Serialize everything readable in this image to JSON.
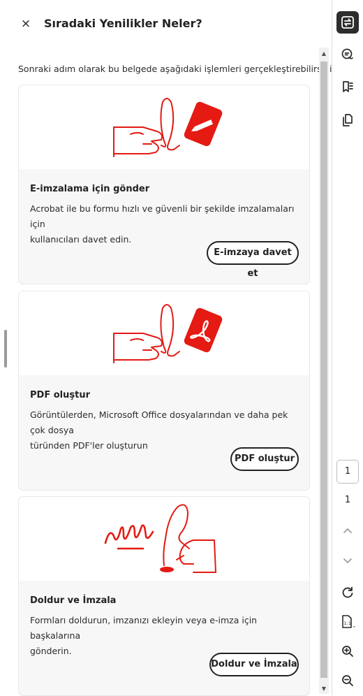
{
  "header": {
    "close_label": "×",
    "title": "Sıradaki Yenilikler Neler?"
  },
  "intro": "Sonraki adım olarak bu belgede aşağıdaki işlemleri gerçekleştirebilirsiniz.",
  "cards": [
    {
      "title": "E-imzalama için gönder",
      "desc_line1": "Acrobat ile bu formu hızlı ve güvenli bir şekilde imzalamaları için",
      "desc_line2": "kullanıcıları davet edin.",
      "button": "E-imzaya davet et",
      "illustration": "hand-pen-sign-icon"
    },
    {
      "title": "PDF oluştur",
      "desc_line1": "Görüntülerden, Microsoft Office dosyalarından ve daha pek çok dosya",
      "desc_line2": "türünden PDF'ler oluşturun",
      "button": "PDF oluştur",
      "illustration": "hand-acrobat-pdf-icon"
    },
    {
      "title": "Doldur ve İmzala",
      "desc_line1": "Formları doldurun, imzanızı ekleyin veya e-imza için başkalarına",
      "desc_line2": "gönderin.",
      "button": "Doldur ve İmzala",
      "illustration": "hand-signature-icon"
    }
  ],
  "rightbar": {
    "icons": [
      "convert-icon",
      "comment-icon",
      "bookmark-icon",
      "copy-pages-icon",
      "chevron-up-icon",
      "chevron-down-icon",
      "refresh-icon",
      "actual-size-icon",
      "zoom-in-icon",
      "zoom-out-icon"
    ],
    "page_current": "1",
    "page_total": "1"
  },
  "colors": {
    "accent_red": "#e41a13",
    "active_tool_bg": "#2d2d2d",
    "card_bg": "#f7f7f7"
  }
}
